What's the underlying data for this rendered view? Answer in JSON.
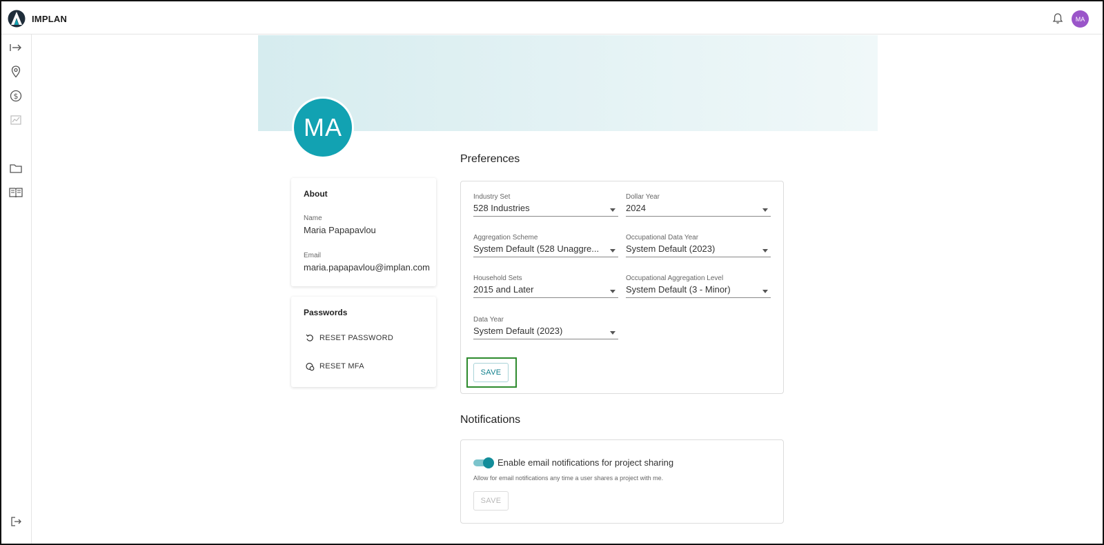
{
  "app": {
    "brand": "IMPLAN",
    "user_initials": "MA"
  },
  "sidebar": {
    "items": [
      "expand-icon",
      "location-icon",
      "dollar-icon",
      "chart-icon",
      "folder-icon",
      "book-icon"
    ],
    "bottom": "logout-icon"
  },
  "profile": {
    "initials": "MA"
  },
  "about": {
    "title": "About",
    "name_label": "Name",
    "name_value": "Maria Papapavlou",
    "email_label": "Email",
    "email_value": "maria.papapavlou@implan.com"
  },
  "passwords": {
    "title": "Passwords",
    "reset_password": "RESET PASSWORD",
    "reset_mfa": "RESET MFA"
  },
  "preferences": {
    "title": "Preferences",
    "fields": [
      {
        "label": "Industry Set",
        "value": "528 Industries"
      },
      {
        "label": "Dollar Year",
        "value": "2024"
      },
      {
        "label": "Aggregation Scheme",
        "value": "System Default (528 Unaggre..."
      },
      {
        "label": "Occupational Data Year",
        "value": "System Default (2023)"
      },
      {
        "label": "Household Sets",
        "value": "2015 and Later"
      },
      {
        "label": "Occupational Aggregation Level",
        "value": "System Default (3 - Minor)"
      },
      {
        "label": "Data Year",
        "value": "System Default (2023)"
      }
    ],
    "save_label": "SAVE"
  },
  "notifications": {
    "title": "Notifications",
    "toggle_label": "Enable email notifications for project sharing",
    "toggle_on": true,
    "help": "Allow for email notifications any time a user shares a project with me.",
    "save_label": "SAVE"
  },
  "colors": {
    "accent": "#12a2b2",
    "avatar_purple": "#9a55c9",
    "highlight": "#2c8a2c"
  }
}
